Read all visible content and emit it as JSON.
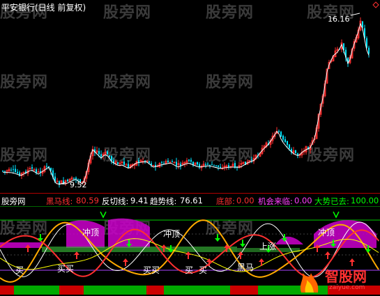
{
  "window": {
    "title": "平安银行(日线 前复权)"
  },
  "price_chart": {
    "high_label": "16.16",
    "low_label": "9.52",
    "colors": {
      "up": "#ff3030",
      "down": "#00e5ff",
      "ma": "#ffffff"
    }
  },
  "indicator": {
    "name": "股旁网",
    "items": [
      {
        "label": "黑马线:",
        "value": "80.59",
        "color": "#ff3030"
      },
      {
        "label": "反切线:",
        "value": "9.41",
        "color": "#ffffff"
      },
      {
        "label": "趋势线:",
        "value": "76.61",
        "color": "#ffffff"
      },
      {
        "label": "底部:",
        "value": "0.00",
        "color": "#ff3030"
      },
      {
        "label": "机会来临:",
        "value": "0.00",
        "color": "#ff40ff"
      },
      {
        "label": "大势已去:",
        "value": "100.00",
        "color": "#00ff00"
      }
    ],
    "annotations": {
      "buy": "买",
      "buy2": "买买",
      "top": "冲顶",
      "black_horse": "黑马",
      "up": "上涨"
    }
  },
  "watermark": "股旁网",
  "logo": {
    "text": "智股网",
    "url": "zaiyue.com"
  },
  "chart_data": {
    "type": "candlestick",
    "title": "平安银行(日线 前复权)",
    "annotated_high": 16.16,
    "annotated_low": 9.52,
    "indicator_values": {
      "黑马线": 80.59,
      "反切线": 9.41,
      "趋势线": 76.61,
      "底部": 0.0,
      "机会来临": 0.0,
      "大势已去": 100.0
    }
  }
}
